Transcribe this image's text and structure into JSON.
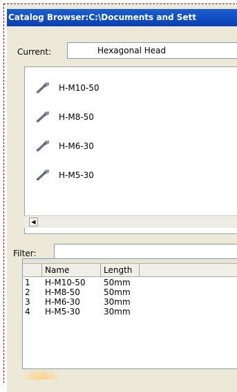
{
  "window": {
    "title": "Catalog Browser:C:\\Documents and Sett"
  },
  "current": {
    "label": "Current:",
    "value": "Hexagonal Head"
  },
  "items": [
    {
      "label": "H-M10-50",
      "icon": "bolt-icon"
    },
    {
      "label": "H-M8-50",
      "icon": "bolt-icon"
    },
    {
      "label": "H-M6-30",
      "icon": "bolt-icon"
    },
    {
      "label": "H-M5-30",
      "icon": "bolt-icon"
    }
  ],
  "scrollbar": {
    "left_arrow": "◀"
  },
  "filter": {
    "label": "Filter:",
    "value": ""
  },
  "table": {
    "columns": [
      "Name",
      "Length"
    ],
    "rows": [
      {
        "index": "1",
        "name": "H-M10-50",
        "length": "50mm"
      },
      {
        "index": "2",
        "name": "H-M8-50",
        "length": "50mm"
      },
      {
        "index": "3",
        "name": "H-M6-30",
        "length": "30mm"
      },
      {
        "index": "4",
        "name": "H-M5-30",
        "length": "30mm"
      }
    ]
  },
  "colors": {
    "titlebar": "#0a3fb3",
    "dialog_bg": "#ece9d8",
    "frame_dash": "#c00000"
  }
}
